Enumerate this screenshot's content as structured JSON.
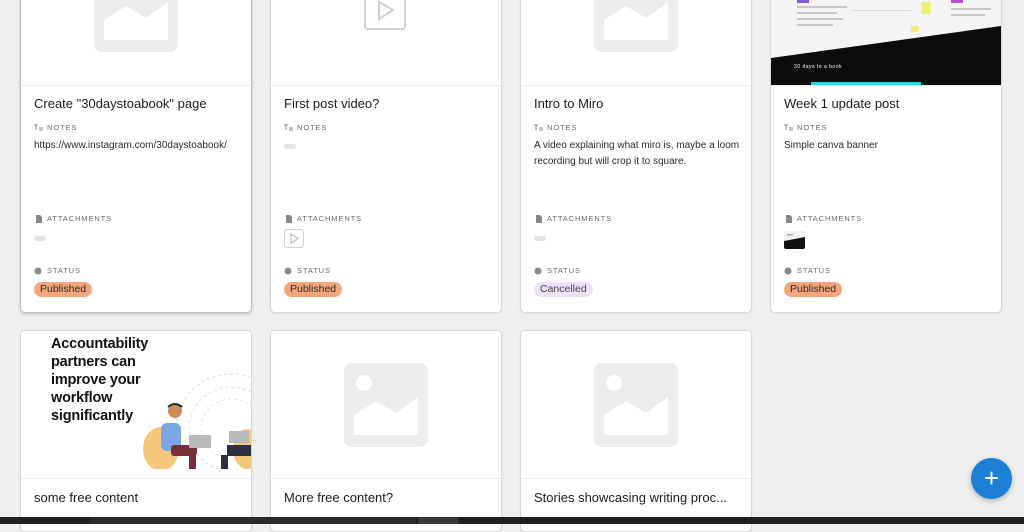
{
  "cards": [
    {
      "title": "Create \"30daystoabook\" page",
      "notes_label": "NOTES",
      "notes": "https://www.instagram.com/30daystoabook/",
      "attachments_label": "ATTACHMENTS",
      "status_label": "STATUS",
      "status": "Published"
    },
    {
      "title": "First post video?",
      "notes_label": "NOTES",
      "notes": "",
      "attachments_label": "ATTACHMENTS",
      "attachment_icon": "play-icon",
      "status_label": "STATUS",
      "status": "Published"
    },
    {
      "title": "Intro to Miro",
      "notes_label": "NOTES",
      "notes": "A video explaining what miro is, maybe a loom recording but will crop it to square.",
      "attachments_label": "ATTACHMENTS",
      "status_label": "STATUS",
      "status": "Cancelled"
    },
    {
      "title": "Week 1 update post",
      "notes_label": "NOTES",
      "notes": "Simple canva banner",
      "attachments_label": "ATTACHMENTS",
      "cover_caption": "30 days to a book",
      "status_label": "STATUS",
      "status": "Published"
    },
    {
      "title": "some free content",
      "cover_text": "Accountability partners can improve your workflow significantly"
    },
    {
      "title": "More free content?"
    },
    {
      "title": "Stories showcasing writing proc..."
    }
  ],
  "fab": {
    "label": "+",
    "icon": "plus-icon"
  },
  "colors": {
    "published": "#f4a57c",
    "cancelled": "#ece3fb",
    "fab": "#1d7fd6"
  }
}
